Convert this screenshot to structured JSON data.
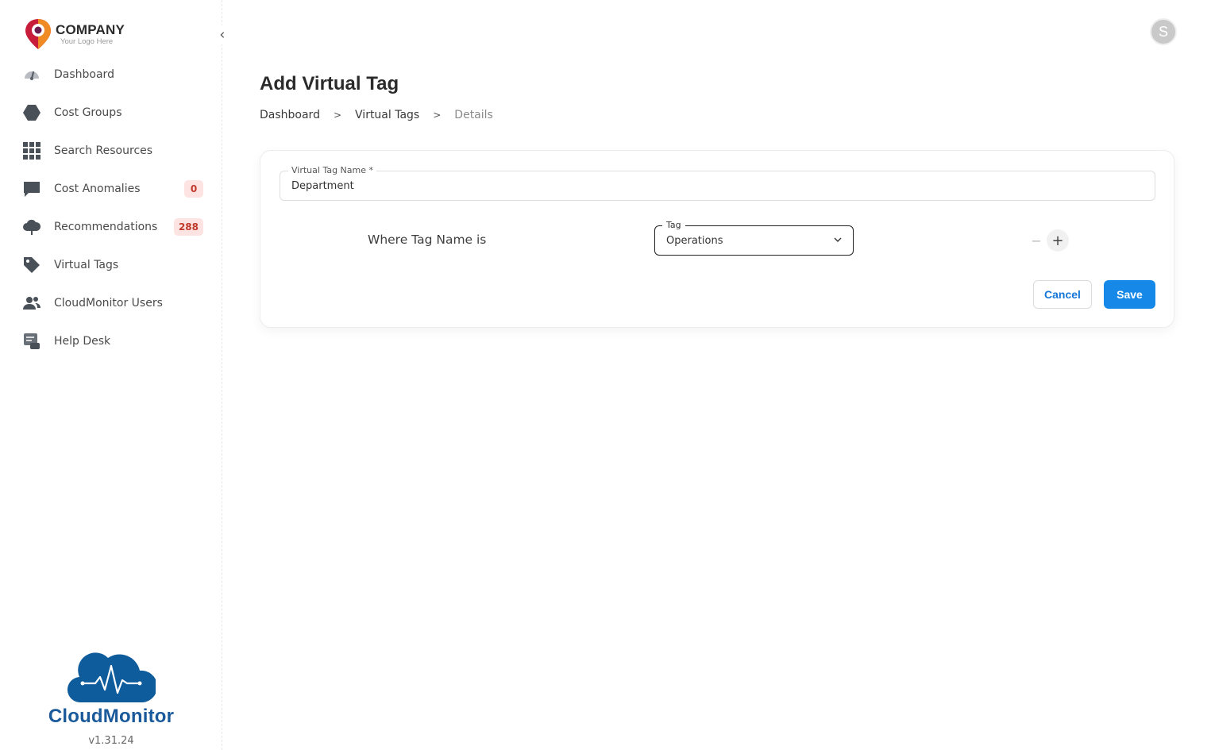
{
  "brand": {
    "logo_title": "COMPANY",
    "logo_subtitle": "Your Logo Here",
    "product_name": "CloudMonitor",
    "version": "v1.31.24",
    "accent": "#1688e8",
    "product_color": "#1a5a9a"
  },
  "sidebar": {
    "collapse_icon": "chevron-left-icon",
    "items": [
      {
        "label": "Dashboard",
        "icon": "gauge-icon"
      },
      {
        "label": "Cost Groups",
        "icon": "hexagon-icon"
      },
      {
        "label": "Search Resources",
        "icon": "grid-icon"
      },
      {
        "label": "Cost Anomalies",
        "icon": "chat-bubble-icon",
        "badge": "0"
      },
      {
        "label": "Recommendations",
        "icon": "cloud-icon",
        "badge": "288"
      },
      {
        "label": "Virtual Tags",
        "icon": "tag-icon"
      },
      {
        "label": "CloudMonitor Users",
        "icon": "users-icon"
      },
      {
        "label": "Help Desk",
        "icon": "helpdesk-icon"
      }
    ]
  },
  "header": {
    "avatar_initial": "S"
  },
  "main": {
    "title": "Add Virtual Tag",
    "breadcrumb": {
      "items": [
        "Dashboard",
        "Virtual Tags",
        "Details"
      ],
      "separator": ">"
    },
    "form": {
      "name_label": "Virtual Tag Name *",
      "name_value": "Department",
      "where_label": "Where Tag Name is",
      "tag_label": "Tag",
      "tag_value": "Operations",
      "minus_label": "−",
      "plus_label": "+",
      "cancel_label": "Cancel",
      "save_label": "Save"
    }
  }
}
